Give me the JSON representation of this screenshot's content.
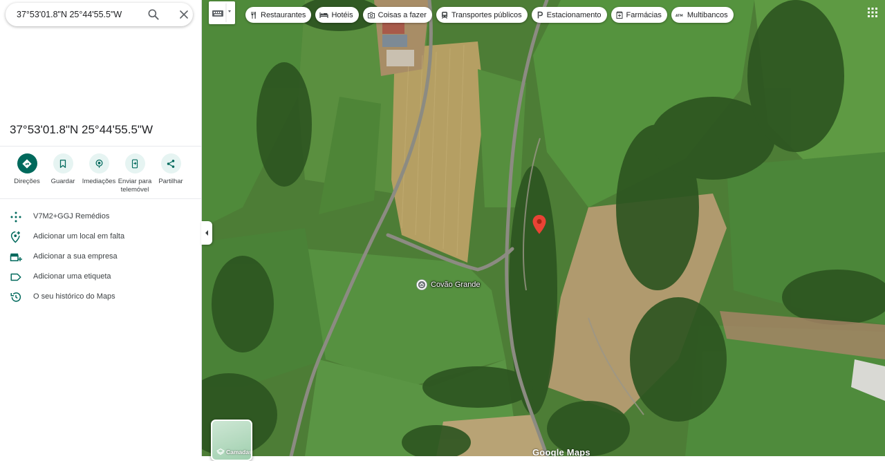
{
  "search": {
    "value": "37°53'01.8\"N 25°44'55.5\"W"
  },
  "place": {
    "title": "37°53'01.8\"N 25°44'55.5\"W"
  },
  "actions": [
    {
      "label": "Direções",
      "icon": "directions-icon"
    },
    {
      "label": "Guardar",
      "icon": "bookmark-icon"
    },
    {
      "label": "Imediações",
      "icon": "nearby-icon"
    },
    {
      "label": "Enviar para telemóvel",
      "icon": "send-to-phone-icon"
    },
    {
      "label": "Partilhar",
      "icon": "share-icon"
    }
  ],
  "details": [
    {
      "label": "V7M2+GGJ Remédios",
      "icon": "plus-code-icon"
    },
    {
      "label": "Adicionar um local em falta",
      "icon": "add-location-icon"
    },
    {
      "label": "Adicionar a sua empresa",
      "icon": "add-business-icon"
    },
    {
      "label": "Adicionar uma etiqueta",
      "icon": "label-icon"
    },
    {
      "label": "O seu histórico do Maps",
      "icon": "history-icon"
    }
  ],
  "map": {
    "chips": [
      {
        "label": "Restaurantes",
        "icon": "restaurant-icon"
      },
      {
        "label": "Hotéis",
        "icon": "hotel-icon"
      },
      {
        "label": "Coisas a fazer",
        "icon": "camera-icon"
      },
      {
        "label": "Transportes públicos",
        "icon": "transit-icon"
      },
      {
        "label": "Estacionamento",
        "icon": "parking-icon"
      },
      {
        "label": "Farmácias",
        "icon": "pharmacy-icon"
      },
      {
        "label": "Multibancos",
        "icon": "atm-icon"
      }
    ],
    "place_label": "Covão Grande",
    "layers_label": "Camadas",
    "logo": "Google Maps"
  },
  "colors": {
    "accent": "#00695c",
    "accent_light": "#e6f4f2",
    "pin": "#ea4335"
  }
}
